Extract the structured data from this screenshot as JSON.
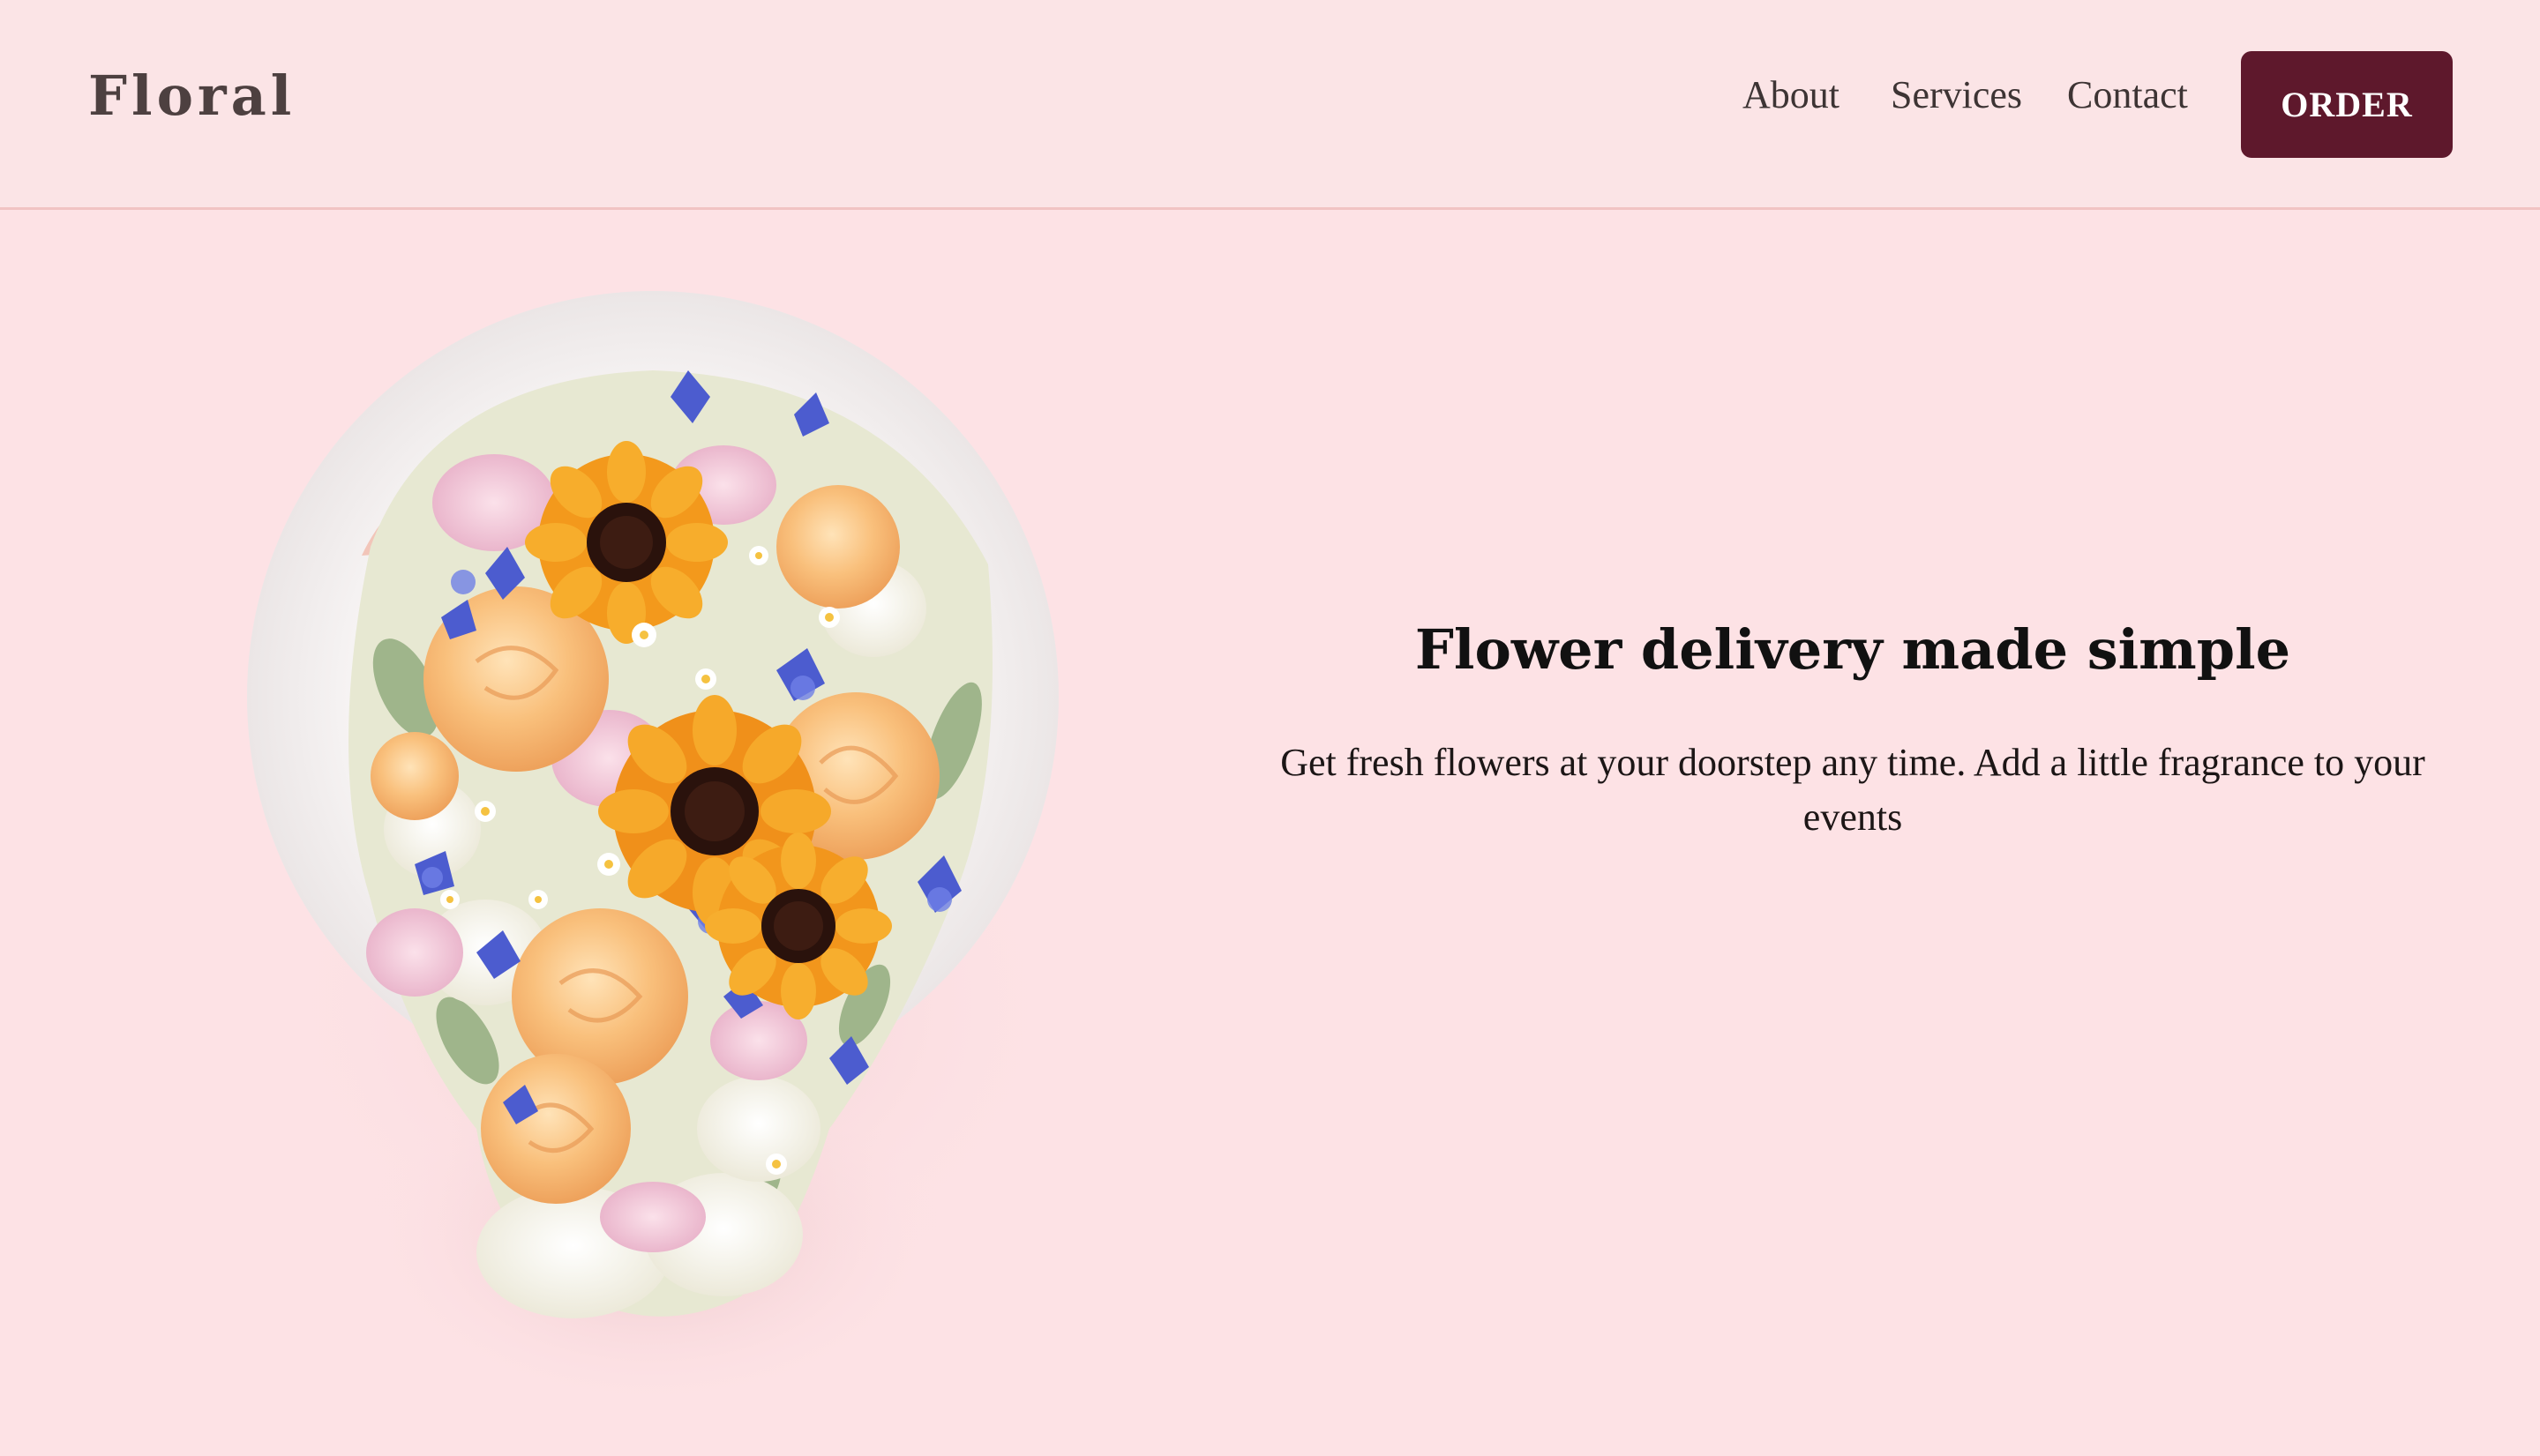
{
  "brand": {
    "logo_text": "Floral"
  },
  "nav": {
    "items": [
      {
        "label": "About"
      },
      {
        "label": "Services"
      },
      {
        "label": "Contact"
      }
    ],
    "cta_label": "ORDER"
  },
  "hero": {
    "title": "Flower delivery made simple",
    "description": "Get fresh flowers at your doorstep any time. Add a little fragrance to your events",
    "image_icon": "flower-bouquet-image"
  },
  "colors": {
    "page_background": "#fde2e5",
    "header_background": "#fbe4e6",
    "cta_background": "#5e182c",
    "cta_text": "#ffffff",
    "heading_text": "#111111",
    "nav_text": "#3d3434"
  }
}
